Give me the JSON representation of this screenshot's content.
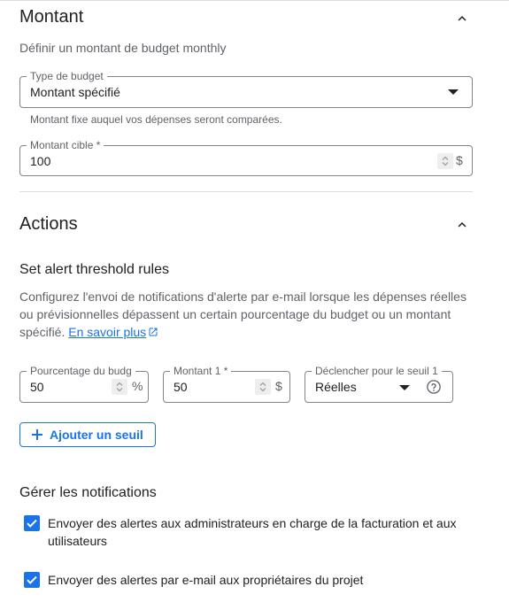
{
  "montant": {
    "title": "Montant",
    "subtitle": "Définir un montant de budget monthly",
    "type_budget": {
      "label": "Type de budget",
      "value": "Montant spécifié",
      "hint": "Montant fixe auquel vos dépenses seront comparées."
    },
    "montant_cible": {
      "label": "Montant cible *",
      "value": "100",
      "unit": "$"
    }
  },
  "actions": {
    "title": "Actions",
    "threshold_heading": "Set alert threshold rules",
    "description": "Configurez l'envoi de notifications d'alerte par e-mail lorsque les dépenses réelles ou prévisionnelles dépassent un certain pourcentage du budget ou un montant spécifié.",
    "learn_more": "En savoir plus",
    "threshold": {
      "percent_label": "Pourcentage du budg",
      "percent_value": "50",
      "percent_unit": "%",
      "amount_label": "Montant 1 *",
      "amount_value": "50",
      "amount_unit": "$",
      "trigger_label": "Déclencher pour le seuil 1",
      "trigger_value": "Réelles"
    },
    "add_threshold": "Ajouter un seuil"
  },
  "notifications": {
    "heading": "Gérer les notifications",
    "option1": "Envoyer des alertes aux administrateurs en charge de la facturation et aux utilisateurs",
    "option1_checked": true,
    "option2": "Envoyer des alertes par e-mail aux propriétaires du projet",
    "option2_checked": true
  },
  "colors": {
    "accent": "#1a73e8",
    "text": "#202124",
    "muted": "#5f6368",
    "border": "#80868b"
  },
  "icons": {
    "collapse": "chevron-up-icon",
    "dropdown": "dropdown-arrow-icon",
    "external": "external-link-icon",
    "help": "help-circle-icon",
    "add": "plus-icon",
    "check": "checkbox-checked-icon"
  }
}
